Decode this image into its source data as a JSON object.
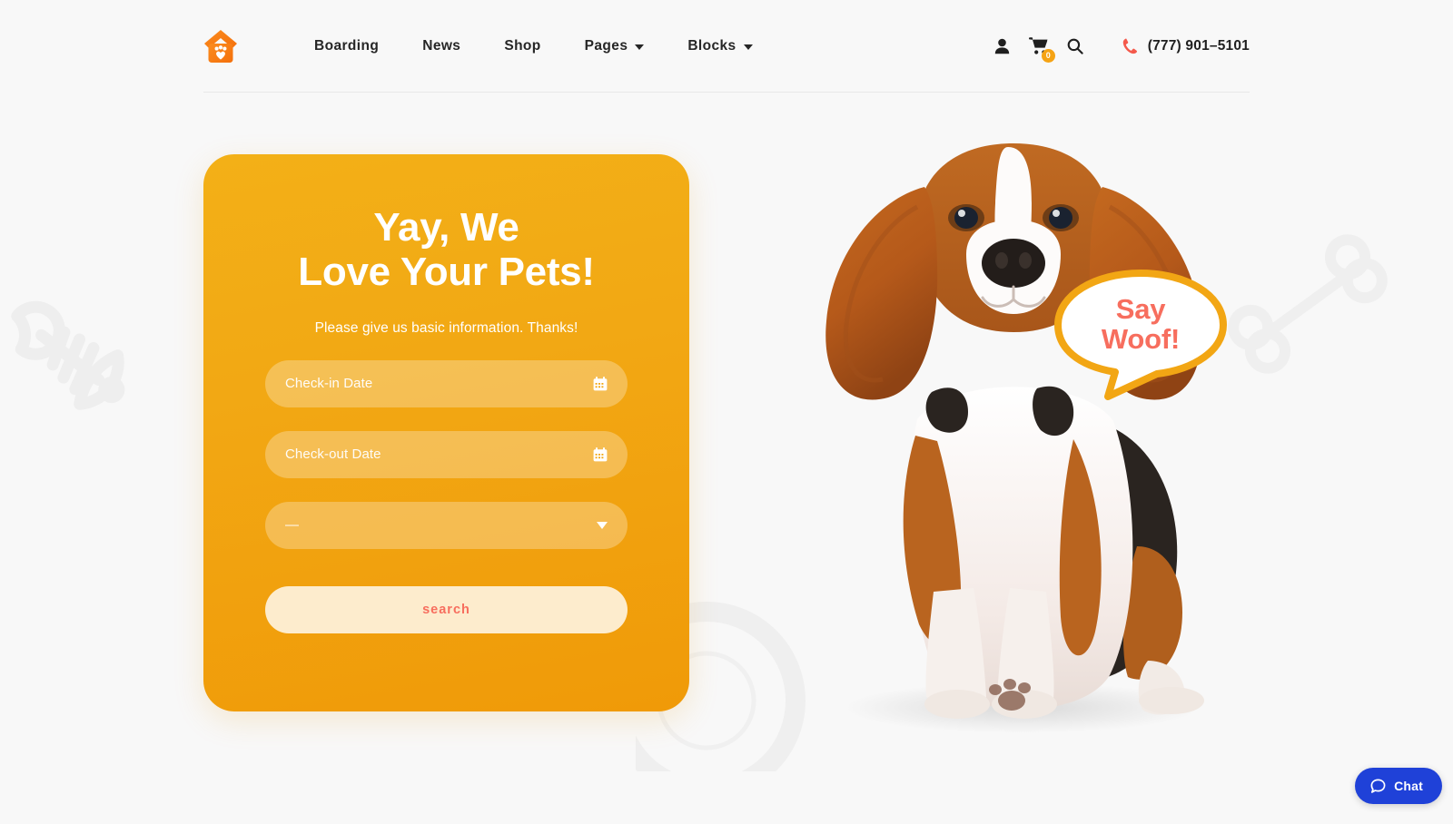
{
  "site": {
    "logo_icon": "house-paw-logo-icon",
    "background_color": "#f8f8f8"
  },
  "header": {
    "nav": [
      {
        "label": "Boarding",
        "has_dropdown": false
      },
      {
        "label": "News",
        "has_dropdown": false
      },
      {
        "label": "Shop",
        "has_dropdown": false
      },
      {
        "label": "Pages",
        "has_dropdown": true
      },
      {
        "label": "Blocks",
        "has_dropdown": true
      }
    ],
    "account_icon": "user-icon",
    "cart_icon": "shopping-cart-icon",
    "cart_count": "0",
    "search_icon": "search-icon",
    "phone_icon": "phone-icon",
    "phone_number": "(777) 901–5101",
    "phone_icon_color": "#f4594b",
    "cart_badge_color": "#f5a314"
  },
  "hero": {
    "card": {
      "title_line1": "Yay, We",
      "title_line2": "Love Your Pets!",
      "subtitle": "Please give us basic information. Thanks!",
      "gradient_from": "#f3b017",
      "gradient_to": "#f09a08",
      "fields": [
        {
          "placeholder": "Check-in Date",
          "icon": "calendar-icon",
          "type": "date"
        },
        {
          "placeholder": "Check-out Date",
          "icon": "calendar-icon",
          "type": "date"
        },
        {
          "placeholder": "—",
          "icon": "chevron-down-icon",
          "type": "select"
        }
      ],
      "search_button_label": "search",
      "search_button_bg": "#fdeccd",
      "search_button_color": "#f76e5e"
    },
    "speech_bubble": {
      "line1": "Say",
      "line2": "Woof!",
      "text_color": "#f76e5e",
      "border_color": "#f2a614"
    },
    "photo_alt": "beagle-puppy-photo",
    "decorations": [
      {
        "name": "fish-bone-decoration"
      },
      {
        "name": "dog-bone-decoration"
      },
      {
        "name": "concentric-rings-decoration"
      }
    ]
  },
  "chat": {
    "label": "Chat",
    "icon": "chat-bubble-icon",
    "background": "#1f41d8"
  }
}
